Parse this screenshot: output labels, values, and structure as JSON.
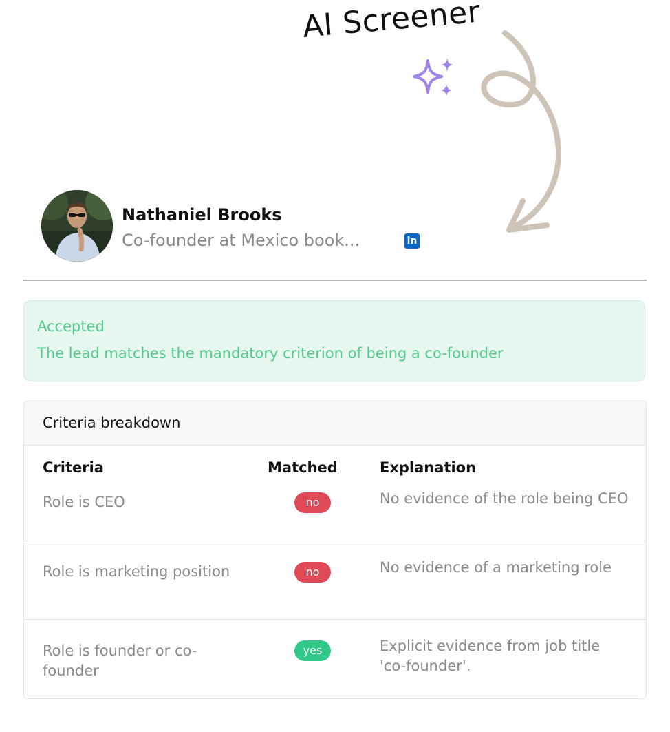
{
  "annotation": {
    "text": "AI Screener",
    "sparkle_color": "#9d84e6",
    "arrow_color": "#cdc3b7"
  },
  "profile": {
    "name": "Nathaniel Brooks",
    "subtitle": "Co-founder at Mexico book...",
    "linkedin_icon": "linkedin-icon",
    "linkedin_glyph": "in"
  },
  "status": {
    "title": "Accepted",
    "description": "The lead matches the mandatory criterion of being a co-founder",
    "color": "#52cc8c"
  },
  "criteria": {
    "title": "Criteria breakdown",
    "headers": {
      "criteria": "Criteria",
      "matched": "Matched",
      "explanation": "Explanation"
    },
    "rows": [
      {
        "criteria": "Role is CEO",
        "matched": "no",
        "explanation": "No evidence of the role being CEO"
      },
      {
        "criteria": "Role is marketing position",
        "matched": "no",
        "explanation": "No evidence of a marketing role"
      },
      {
        "criteria": "Role is founder or co-founder",
        "matched": "yes",
        "explanation": "Explicit evidence from job title 'co-founder'."
      }
    ]
  }
}
